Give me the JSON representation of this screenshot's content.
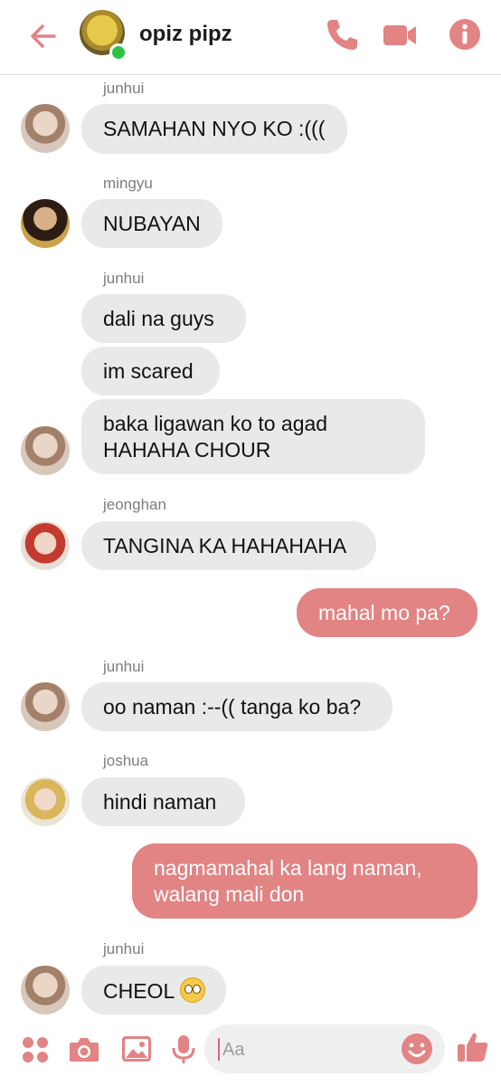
{
  "header": {
    "title": "opiz pipz"
  },
  "messages": [
    {
      "sender": "junhui",
      "text": "SAMAHAN NYO KO :((("
    },
    {
      "sender": "mingyu",
      "text": "NUBAYAN"
    },
    {
      "sender": "junhui",
      "text": "dali na guys"
    },
    {
      "text": "im scared"
    },
    {
      "text_line1": "baka ligawan ko to agad",
      "text_line2": "HAHAHA CHOUR"
    },
    {
      "sender": "jeonghan",
      "text": "TANGINA KA HAHAHAHA"
    },
    {
      "text": "mahal mo pa?"
    },
    {
      "sender": "junhui",
      "text": "oo naman :--(( tanga ko ba?"
    },
    {
      "sender": "joshua",
      "text": "hindi naman"
    },
    {
      "text_line1": "nagmamahal ka lang naman,",
      "text_line2": "walang mali don"
    },
    {
      "sender": "junhui",
      "text": "CHEOL"
    }
  ],
  "composer": {
    "placeholder": "Aa"
  },
  "colors": {
    "accent": "#e28384",
    "incoming": "#e9e9e9",
    "online": "#2fc146"
  }
}
